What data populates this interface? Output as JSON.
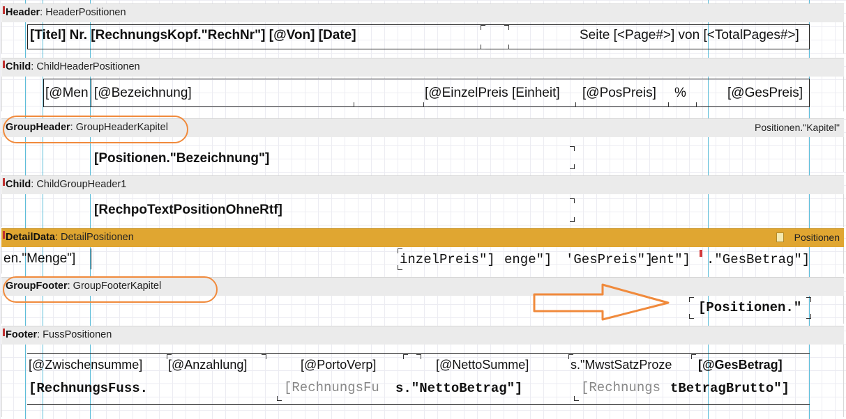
{
  "bands": {
    "header": {
      "kind": "Header",
      "name": "HeaderPositionen",
      "fields": {
        "title": "[Titel] Nr. [RechnungsKopf.\"RechNr\"] [@Von] [Date]",
        "pages": "Seite [<Page#>] von [<TotalPages#>]"
      }
    },
    "child1": {
      "kind": "Child",
      "name": "ChildHeaderPositionen",
      "fields": {
        "menge": "[@Men",
        "bez": "[@Bezeichnung]",
        "einzel": "[@EinzelPreis",
        "einheit": "[Einheit]",
        "pospreis": "[@PosPreis]",
        "pct": "%",
        "gespreis": "[@GesPreis]"
      }
    },
    "groupheader": {
      "kind": "GroupHeader",
      "name": "GroupHeaderKapitel",
      "right": "Positionen.\"Kapitel\"",
      "fields": {
        "bez": "[Positionen.\"Bezeichnung\"]"
      }
    },
    "child2": {
      "kind": "Child",
      "name": "ChildGroupHeader1",
      "fields": {
        "rtf": "[RechpoTextPositionOhneRtf]"
      }
    },
    "detail": {
      "kind": "DetailData",
      "name": "DetailPositionen",
      "right": "Positionen",
      "fields": {
        "menge": "en.\"Menge\"]",
        "einzel": "inzelPreis\"]",
        "enge": "enge\"]",
        "gespreis": "'GesPreis\"]",
        "ent": "ent\"]",
        "gesbetrag": ".\"GesBetrag\"]"
      }
    },
    "groupfooter": {
      "kind": "GroupFooter",
      "name": "GroupFooterKapitel",
      "fields": {
        "pos": "[Positionen.\""
      }
    },
    "footer": {
      "kind": "Footer",
      "name": "FussPositionen",
      "fields": {
        "zwischensumme": "[@Zwischensumme]",
        "anzahlung": "[@Anzahlung]",
        "porto": "[@PortoVerp]",
        "netto": "[@NettoSumme]",
        "mwst": "s.\"MwstSatzProze",
        "gesbetrag": "[@GesBetrag]",
        "fuss1": "[RechnungsFuss.",
        "fuss2": "[RechnungsFu",
        "netto_betrag": "s.\"NettoBetrag\"]",
        "fuss3": "[Rechnungs",
        "brutto": "tBetragBrutto\"]"
      }
    }
  },
  "colors": {
    "band": "#ebebeb",
    "detail": "#e0a631",
    "guide": "#3fb1d2",
    "annotation": "#f08a3c"
  },
  "icons": {
    "detail_datasource": "book-icon",
    "arrow": "right-arrow-annotation"
  }
}
